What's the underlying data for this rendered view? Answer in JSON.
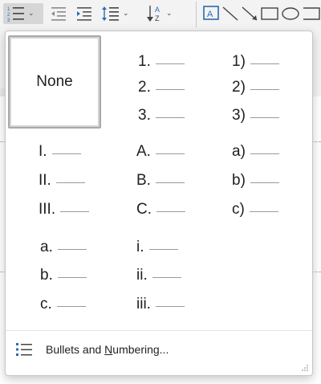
{
  "gallery": {
    "none_label": "None",
    "tiles": [
      [
        "1.",
        "2.",
        "3."
      ],
      [
        "1)",
        "2)",
        "3)"
      ],
      [
        "I.",
        "II.",
        "III."
      ],
      [
        "A.",
        "B.",
        "C."
      ],
      [
        "a)",
        "b)",
        "c)"
      ],
      [
        "a.",
        "b.",
        "c."
      ],
      [
        "i.",
        "ii.",
        "iii."
      ]
    ],
    "footer": {
      "label_prefix": "Bullets and ",
      "label_access_key": "N",
      "label_suffix": "umbering...",
      "icon": "list-icon"
    }
  },
  "colors": {
    "accent": "#2b6cb0",
    "selected_border": "#a8a8a8"
  }
}
